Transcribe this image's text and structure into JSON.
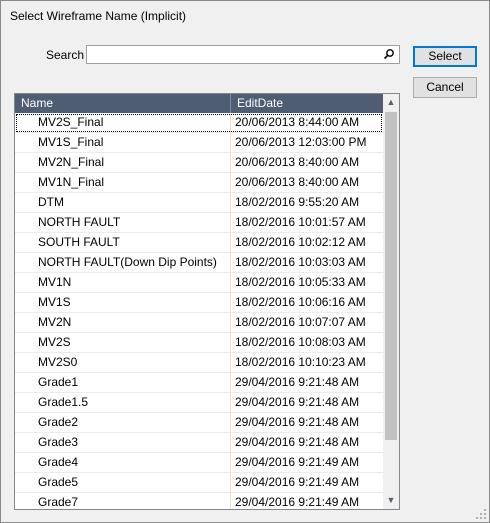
{
  "window": {
    "title": "Select Wireframe Name (Implicit)"
  },
  "search": {
    "label": "Search",
    "value": "",
    "icon": "search-icon"
  },
  "buttons": {
    "select_label": "Select",
    "cancel_label": "Cancel"
  },
  "grid": {
    "columns": [
      "Name",
      "EditDate"
    ],
    "rows": [
      [
        "MV2S_Final",
        "20/06/2013 8:44:00 AM"
      ],
      [
        "MV1S_Final",
        "20/06/2013 12:03:00 PM"
      ],
      [
        "MV2N_Final",
        "20/06/2013 8:40:00 AM"
      ],
      [
        "MV1N_Final",
        "20/06/2013 8:40:00 AM"
      ],
      [
        "DTM",
        "18/02/2016 9:55:20 AM"
      ],
      [
        "NORTH FAULT",
        "18/02/2016 10:01:57 AM"
      ],
      [
        "SOUTH FAULT",
        "18/02/2016 10:02:12 AM"
      ],
      [
        "NORTH FAULT(Down Dip Points)",
        "18/02/2016 10:03:03 AM"
      ],
      [
        "MV1N",
        "18/02/2016 10:05:33 AM"
      ],
      [
        "MV1S",
        "18/02/2016 10:06:16 AM"
      ],
      [
        "MV2N",
        "18/02/2016 10:07:07 AM"
      ],
      [
        "MV2S",
        "18/02/2016 10:08:03 AM"
      ],
      [
        "MV2S0",
        "18/02/2016 10:10:23 AM"
      ],
      [
        "Grade1",
        "29/04/2016 9:21:48 AM"
      ],
      [
        "Grade1.5",
        "29/04/2016 9:21:48 AM"
      ],
      [
        "Grade2",
        "29/04/2016 9:21:48 AM"
      ],
      [
        "Grade3",
        "29/04/2016 9:21:48 AM"
      ],
      [
        "Grade4",
        "29/04/2016 9:21:49 AM"
      ],
      [
        "Grade5",
        "29/04/2016 9:21:49 AM"
      ],
      [
        "Grade7",
        "29/04/2016 9:21:49 AM"
      ]
    ]
  },
  "colors": {
    "header_bg": "#4f5d73",
    "focus_border": "#0078d7"
  }
}
